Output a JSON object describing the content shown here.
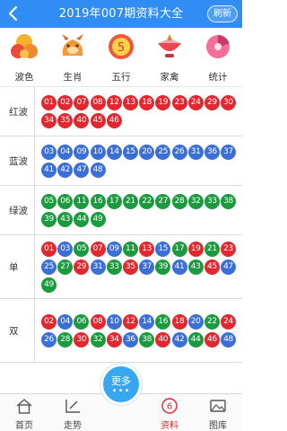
{
  "header": {
    "title": "2019年007期资料大全",
    "refresh_label": "刷新"
  },
  "categories": [
    {
      "label": "波色",
      "icon": "color-wave-icon"
    },
    {
      "label": "生肖",
      "icon": "zodiac-icon"
    },
    {
      "label": "五行",
      "icon": "five-elements-icon",
      "badge": "5"
    },
    {
      "label": "家禽",
      "icon": "poultry-icon"
    },
    {
      "label": "统计",
      "icon": "statistics-icon"
    }
  ],
  "colors": {
    "red": "#e0282e",
    "blue": "#3a6fd8",
    "green": "#1b9a3e",
    "accent": "#2f8df4"
  },
  "sections": [
    {
      "name": "红波",
      "balls": [
        {
          "n": "01",
          "c": "r"
        },
        {
          "n": "02",
          "c": "r"
        },
        {
          "n": "07",
          "c": "r"
        },
        {
          "n": "08",
          "c": "r"
        },
        {
          "n": "12",
          "c": "r"
        },
        {
          "n": "13",
          "c": "r"
        },
        {
          "n": "18",
          "c": "r"
        },
        {
          "n": "19",
          "c": "r"
        },
        {
          "n": "23",
          "c": "r"
        },
        {
          "n": "24",
          "c": "r"
        },
        {
          "n": "29",
          "c": "r"
        },
        {
          "n": "30",
          "c": "r"
        },
        {
          "n": "34",
          "c": "r"
        },
        {
          "n": "35",
          "c": "r"
        },
        {
          "n": "40",
          "c": "r"
        },
        {
          "n": "45",
          "c": "r"
        },
        {
          "n": "46",
          "c": "r"
        }
      ]
    },
    {
      "name": "蓝波",
      "balls": [
        {
          "n": "03",
          "c": "b"
        },
        {
          "n": "04",
          "c": "b"
        },
        {
          "n": "09",
          "c": "b"
        },
        {
          "n": "10",
          "c": "b"
        },
        {
          "n": "14",
          "c": "b"
        },
        {
          "n": "15",
          "c": "b"
        },
        {
          "n": "20",
          "c": "b"
        },
        {
          "n": "25",
          "c": "b"
        },
        {
          "n": "26",
          "c": "b"
        },
        {
          "n": "31",
          "c": "b"
        },
        {
          "n": "36",
          "c": "b"
        },
        {
          "n": "37",
          "c": "b"
        },
        {
          "n": "41",
          "c": "b"
        },
        {
          "n": "42",
          "c": "b"
        },
        {
          "n": "47",
          "c": "b"
        },
        {
          "n": "48",
          "c": "b"
        }
      ]
    },
    {
      "name": "绿波",
      "balls": [
        {
          "n": "05",
          "c": "g"
        },
        {
          "n": "06",
          "c": "g"
        },
        {
          "n": "11",
          "c": "g"
        },
        {
          "n": "16",
          "c": "g"
        },
        {
          "n": "17",
          "c": "g"
        },
        {
          "n": "21",
          "c": "g"
        },
        {
          "n": "22",
          "c": "g"
        },
        {
          "n": "27",
          "c": "g"
        },
        {
          "n": "28",
          "c": "g"
        },
        {
          "n": "32",
          "c": "g"
        },
        {
          "n": "33",
          "c": "g"
        },
        {
          "n": "38",
          "c": "g"
        },
        {
          "n": "39",
          "c": "g"
        },
        {
          "n": "43",
          "c": "g"
        },
        {
          "n": "44",
          "c": "g"
        },
        {
          "n": "49",
          "c": "g"
        }
      ]
    },
    {
      "name": "单",
      "balls": [
        {
          "n": "01",
          "c": "r"
        },
        {
          "n": "03",
          "c": "b"
        },
        {
          "n": "05",
          "c": "g"
        },
        {
          "n": "07",
          "c": "r"
        },
        {
          "n": "09",
          "c": "b"
        },
        {
          "n": "11",
          "c": "g"
        },
        {
          "n": "13",
          "c": "r"
        },
        {
          "n": "15",
          "c": "b"
        },
        {
          "n": "17",
          "c": "g"
        },
        {
          "n": "19",
          "c": "r"
        },
        {
          "n": "21",
          "c": "g"
        },
        {
          "n": "23",
          "c": "r"
        },
        {
          "n": "25",
          "c": "b"
        },
        {
          "n": "27",
          "c": "g"
        },
        {
          "n": "29",
          "c": "r"
        },
        {
          "n": "31",
          "c": "b"
        },
        {
          "n": "33",
          "c": "g"
        },
        {
          "n": "35",
          "c": "r"
        },
        {
          "n": "37",
          "c": "b"
        },
        {
          "n": "39",
          "c": "g"
        },
        {
          "n": "41",
          "c": "b"
        },
        {
          "n": "43",
          "c": "g"
        },
        {
          "n": "45",
          "c": "r"
        },
        {
          "n": "47",
          "c": "b"
        },
        {
          "n": "49",
          "c": "g"
        }
      ]
    },
    {
      "name": "双",
      "balls": [
        {
          "n": "02",
          "c": "r"
        },
        {
          "n": "04",
          "c": "b"
        },
        {
          "n": "06",
          "c": "g"
        },
        {
          "n": "08",
          "c": "r"
        },
        {
          "n": "10",
          "c": "b"
        },
        {
          "n": "12",
          "c": "r"
        },
        {
          "n": "14",
          "c": "b"
        },
        {
          "n": "16",
          "c": "g"
        },
        {
          "n": "18",
          "c": "r"
        },
        {
          "n": "20",
          "c": "b"
        },
        {
          "n": "22",
          "c": "g"
        },
        {
          "n": "24",
          "c": "r"
        },
        {
          "n": "26",
          "c": "b"
        },
        {
          "n": "28",
          "c": "g"
        },
        {
          "n": "30",
          "c": "r"
        },
        {
          "n": "32",
          "c": "g"
        },
        {
          "n": "34",
          "c": "r"
        },
        {
          "n": "36",
          "c": "b"
        },
        {
          "n": "38",
          "c": "g"
        },
        {
          "n": "40",
          "c": "r"
        },
        {
          "n": "42",
          "c": "b"
        },
        {
          "n": "44",
          "c": "g"
        },
        {
          "n": "46",
          "c": "r"
        },
        {
          "n": "48",
          "c": "b"
        }
      ]
    }
  ],
  "tabbar": {
    "tabs": [
      {
        "label": "首页",
        "icon": "home-icon"
      },
      {
        "label": "走势",
        "icon": "trend-icon"
      },
      {
        "label": "资料",
        "icon": "data-icon",
        "badge": "6",
        "active": true
      },
      {
        "label": "图库",
        "icon": "gallery-icon"
      }
    ],
    "more_label": "更多"
  }
}
